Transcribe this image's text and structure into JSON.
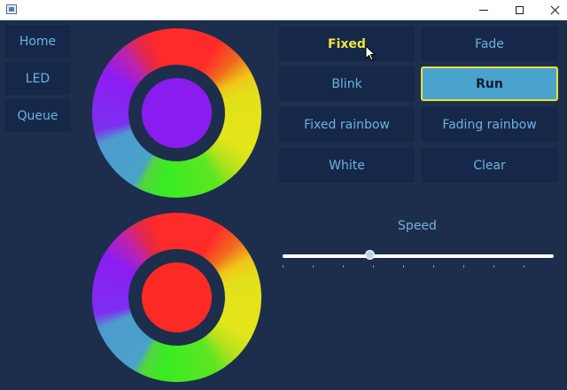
{
  "window": {
    "icon": "app-window-icon",
    "controls": [
      "minimize-icon",
      "maximize-icon",
      "close-icon"
    ]
  },
  "sidebar": {
    "items": [
      {
        "label": "Home"
      },
      {
        "label": "LED"
      },
      {
        "label": "Queue"
      }
    ]
  },
  "wheels": {
    "top": {
      "selected_color": "#8a1cf0"
    },
    "bottom": {
      "selected_color": "#fc2a25"
    }
  },
  "actions": {
    "fixed": {
      "label": "Fixed",
      "state": "selected"
    },
    "fade": {
      "label": "Fade"
    },
    "blink": {
      "label": "Blink"
    },
    "run": {
      "label": "Run",
      "state": "highlighted"
    },
    "fixed_rainbow": {
      "label": "Fixed rainbow"
    },
    "fading_rainbow": {
      "label": "Fading rainbow"
    },
    "white": {
      "label": "White"
    },
    "clear": {
      "label": "Clear"
    }
  },
  "speed": {
    "label": "Speed",
    "value_fraction": 0.32
  },
  "colors": {
    "background": "#1d2e4d",
    "button": "#15284a",
    "text": "#6fb1dc",
    "selected_text": "#f3e43b",
    "run_fill": "#4aa3cc",
    "run_border": "#e6e23a"
  }
}
